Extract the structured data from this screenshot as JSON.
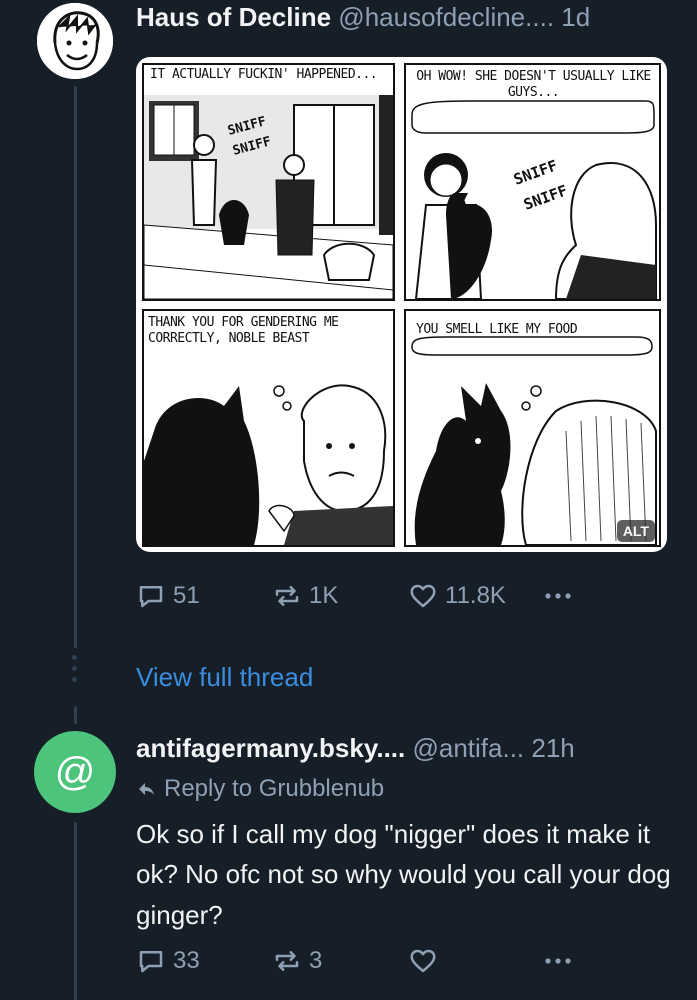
{
  "post": {
    "author_name": "Haus of Decline",
    "author_handle": "@hausofdecline....",
    "time": "1d",
    "comic": {
      "panel1_caption": "IT ACTUALLY FUCKIN' HAPPENED...",
      "panel2_caption": "OH WOW! SHE DOESN'T USUALLY LIKE GUYS...",
      "panel3_caption": "THANK YOU FOR GENDERING ME CORRECTLY, NOBLE BEAST",
      "panel4_caption": "YOU SMELL LIKE MY FOOD",
      "sound_effect": "SNIFF SNIFF",
      "alt_label": "ALT"
    },
    "actions": {
      "replies": "51",
      "reposts": "1K",
      "likes": "11.8K"
    }
  },
  "view_thread_label": "View full thread",
  "reply": {
    "avatar_glyph": "@",
    "author_name": "antifagermany.bsky....",
    "author_handle": "@antifa...",
    "time": "21h",
    "reply_to_label": "Reply to Grubblenub",
    "body": "Ok so if I call my dog \"nigger\" does it make it ok? No ofc not so why would you call your dog ginger?",
    "actions": {
      "replies": "33",
      "reposts": "3"
    }
  },
  "colors": {
    "background": "#161e27",
    "muted": "#8ea0b3",
    "link": "#3b8de0",
    "avatar_green": "#4cc47b"
  }
}
